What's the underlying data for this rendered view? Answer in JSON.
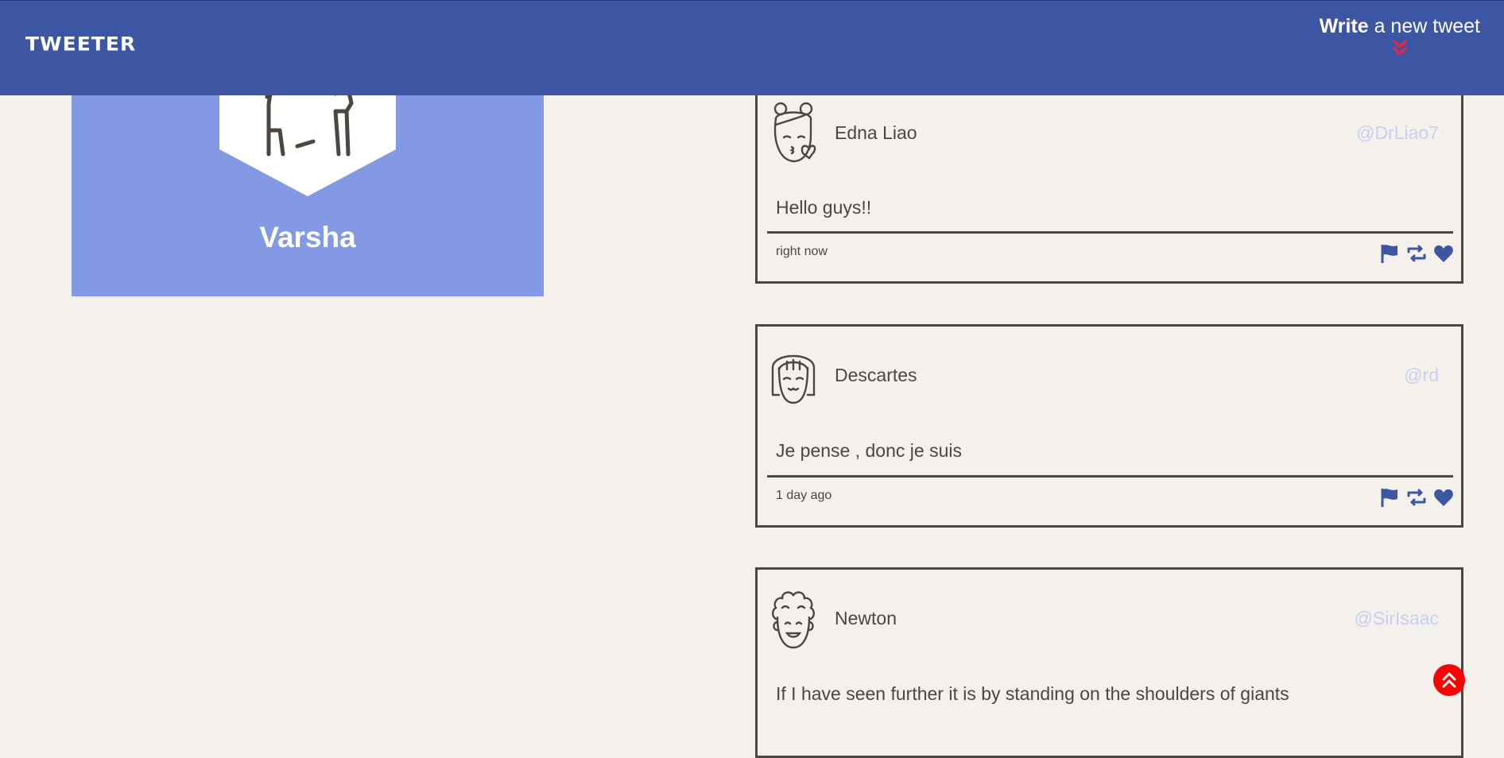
{
  "header": {
    "brand": "TWEETER",
    "compose_bold": "Write",
    "compose_rest": " a new tweet"
  },
  "profile": {
    "name": "Varsha"
  },
  "tweets": [
    {
      "author": "Edna Liao",
      "handle": "@DrLiao7",
      "content": "Hello guys!!",
      "time": "right now",
      "avatar_icon": "girl-kiss-avatar-icon"
    },
    {
      "author": "Descartes",
      "handle": "@rd",
      "content": "Je pense , donc je suis",
      "time": "1 day ago",
      "avatar_icon": "bangs-girl-avatar-icon"
    },
    {
      "author": "Newton",
      "handle": "@SirIsaac",
      "content": "If I have seen further it is by standing on the shoulders of giants",
      "time": "",
      "avatar_icon": "curly-hair-avatar-icon"
    }
  ],
  "colors": {
    "nav": "#3d56a3",
    "profile_bg": "#8399e4",
    "page_bg": "#f4f1ec",
    "text": "#4a4740",
    "handle": "#c6cff0",
    "accent_red": "#ff0000"
  }
}
